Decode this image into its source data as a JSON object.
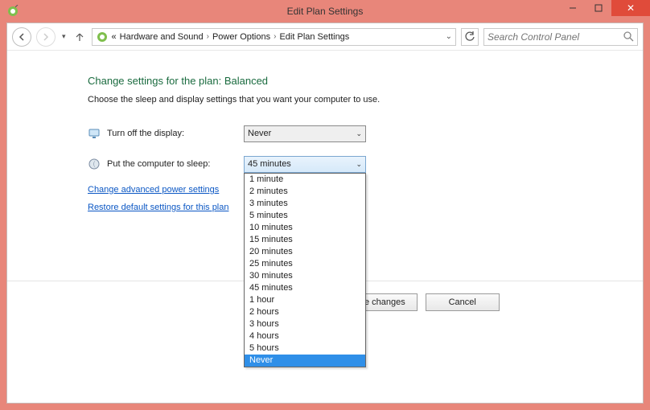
{
  "window": {
    "title": "Edit Plan Settings"
  },
  "toolbar": {
    "breadcrumbs": {
      "prefix": "«",
      "item1": "Hardware and Sound",
      "item2": "Power Options",
      "item3": "Edit Plan Settings"
    },
    "search_placeholder": "Search Control Panel"
  },
  "content": {
    "heading": "Change settings for the plan: Balanced",
    "subtext": "Choose the sleep and display settings that you want your computer to use.",
    "display_label": "Turn off the display:",
    "display_value": "Never",
    "sleep_label": "Put the computer to sleep:",
    "sleep_value": "45 minutes",
    "sleep_options": {
      "o0": "1 minute",
      "o1": "2 minutes",
      "o2": "3 minutes",
      "o3": "5 minutes",
      "o4": "10 minutes",
      "o5": "15 minutes",
      "o6": "20 minutes",
      "o7": "25 minutes",
      "o8": "30 minutes",
      "o9": "45 minutes",
      "o10": "1 hour",
      "o11": "2 hours",
      "o12": "3 hours",
      "o13": "4 hours",
      "o14": "5 hours",
      "o15": "Never"
    },
    "link_advanced": "Change advanced power settings",
    "link_restore": "Restore default settings for this plan",
    "save_label": "Save changes",
    "cancel_label": "Cancel"
  }
}
